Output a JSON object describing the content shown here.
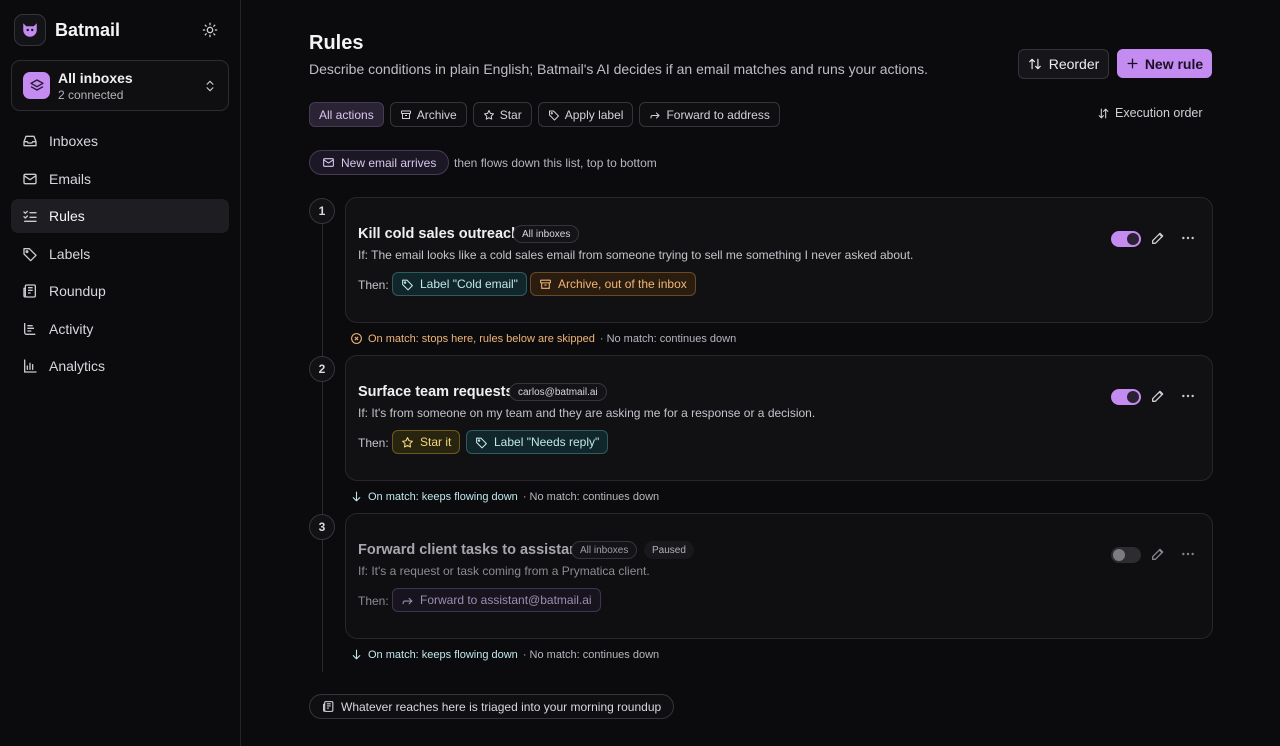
{
  "app": {
    "name": "Batmail"
  },
  "inbox_switcher": {
    "title": "All inboxes",
    "subtitle": "2 connected"
  },
  "sidebar": {
    "items": [
      {
        "label": "Inboxes",
        "icon": "inbox-icon"
      },
      {
        "label": "Emails",
        "icon": "mail-icon"
      },
      {
        "label": "Rules",
        "icon": "list-check-icon",
        "active": true
      },
      {
        "label": "Labels",
        "icon": "tag-icon"
      },
      {
        "label": "Roundup",
        "icon": "newspaper-icon"
      },
      {
        "label": "Activity",
        "icon": "activity-icon"
      },
      {
        "label": "Analytics",
        "icon": "bar-chart-icon"
      }
    ]
  },
  "header": {
    "title": "Rules",
    "subtitle": "Describe conditions in plain English; Batmail's AI decides if an email matches and runs your actions.",
    "reorder_label": "Reorder",
    "new_rule_label": "New rule"
  },
  "filters": [
    {
      "label": "All actions",
      "active": true
    },
    {
      "label": "Archive",
      "icon": "archive-icon"
    },
    {
      "label": "Star",
      "icon": "star-icon"
    },
    {
      "label": "Apply label",
      "icon": "tag-icon"
    },
    {
      "label": "Forward to address",
      "icon": "forward-icon"
    }
  ],
  "execution_order_label": "Execution order",
  "trigger": {
    "label": "New email arrives",
    "note": "then flows down this list, top to bottom"
  },
  "then_label": "Then:",
  "rules": [
    {
      "number": "1",
      "title": "Kill cold sales outreach",
      "scope": "All inboxes",
      "condition": "If: The email looks like a cold sales email from someone trying to sell me something I never asked about.",
      "actions": [
        {
          "label": "Label \"Cold email\"",
          "icon": "tag-icon",
          "tone": "teal"
        },
        {
          "label": "Archive, out of the inbox",
          "icon": "archive-icon",
          "tone": "orange"
        }
      ],
      "enabled": true,
      "on_match": "On match: stops here, rules below are skipped",
      "no_match": "· No match: continues down"
    },
    {
      "number": "2",
      "title": "Surface team requests",
      "scope": "carlos@batmail.ai",
      "condition": "If: It's from someone on my team and they are asking me for a response or a decision.",
      "actions": [
        {
          "label": "Star it",
          "icon": "star-icon",
          "tone": "yellow"
        },
        {
          "label": "Label \"Needs reply\"",
          "icon": "tag-icon",
          "tone": "teal"
        }
      ],
      "enabled": true,
      "on_match": "On match: keeps flowing down",
      "no_match": "· No match: continues down"
    },
    {
      "number": "3",
      "title": "Forward client tasks to assistant",
      "scope": "All inboxes",
      "status": "Paused",
      "condition": "If: It's a request or task coming from a Prymatica client.",
      "actions": [
        {
          "label": "Forward to assistant@batmail.ai",
          "icon": "forward-icon",
          "tone": "purple"
        }
      ],
      "enabled": false,
      "on_match": "On match: keeps flowing down",
      "no_match": "· No match: continues down"
    }
  ],
  "roundup_note": "Whatever reaches here is triaged into your morning roundup",
  "colors": {
    "accent": "#c48bf0",
    "background": "#0b0b0e",
    "teal": "#bfe7ea",
    "orange": "#f0b577",
    "yellow": "#f2d77a"
  }
}
